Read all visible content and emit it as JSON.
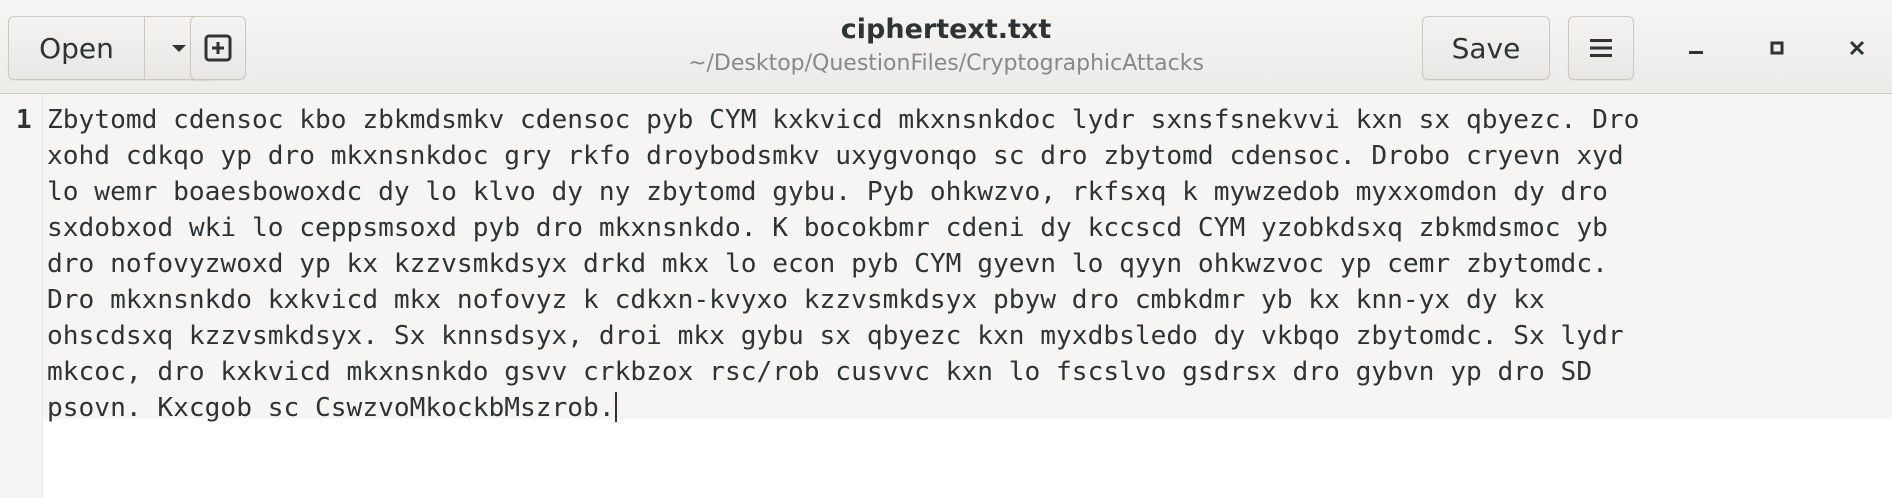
{
  "header": {
    "open_label": "Open",
    "title": "ciphertext.txt",
    "path": "~/Desktop/QuestionFiles/CryptographicAttacks",
    "save_label": "Save"
  },
  "editor": {
    "line_number": "1",
    "lines": [
      "Zbytomd cdensoc kbo zbkmdsmkv cdensoc pyb CYM kxkvicd mkxnsnkdoc lydr sxnsfsnekvvi kxn sx qbyezc. Dro",
      "xohd cdkqo yp dro mkxnsnkdoc gry rkfo droybodsmkv uxygvonqo sc dro zbytomd cdensoc. Drobo cryevn xyd",
      "lo wemr boaesbowoxdc dy lo klvo dy ny zbytomd gybu. Pyb ohkwzvo, rkfsxq k mywzedob myxxomdon dy dro",
      "sxdobxod wki lo ceppsmsoxd pyb dro mkxnsnkdo. K bocokbmr cdeni dy kccscd CYM yzobkdsxq zbkmdsmoc yb",
      "dro nofovyzwoxd yp kx kzzvsmkdsyx drkd mkx lo econ pyb CYM gyevn lo qyyn ohkwzvoc yp cemr zbytomdc.",
      "Dro mkxnsnkdo kxkvicd mkx nofovyz k cdkxn-kvyxo kzzvsmkdsyx pbyw dro cmbkdmr yb kx knn-yx dy kx",
      "ohscdsxq kzzvsmkdsyx. Sx knnsdsyx, droi mkx gybu sx qbyezc kxn myxdbsledo dy vkbqo zbytomdc. Sx lydr",
      "mkcoc, dro kxkvicd mkxnsnkdo gsvv crkbzox rsc/rob cusvvc kxn lo fscslvo gsdrsx dro gybvn yp dro SD",
      "psovn. Kxcgob sc CswzvoMkockbMszrob."
    ]
  }
}
